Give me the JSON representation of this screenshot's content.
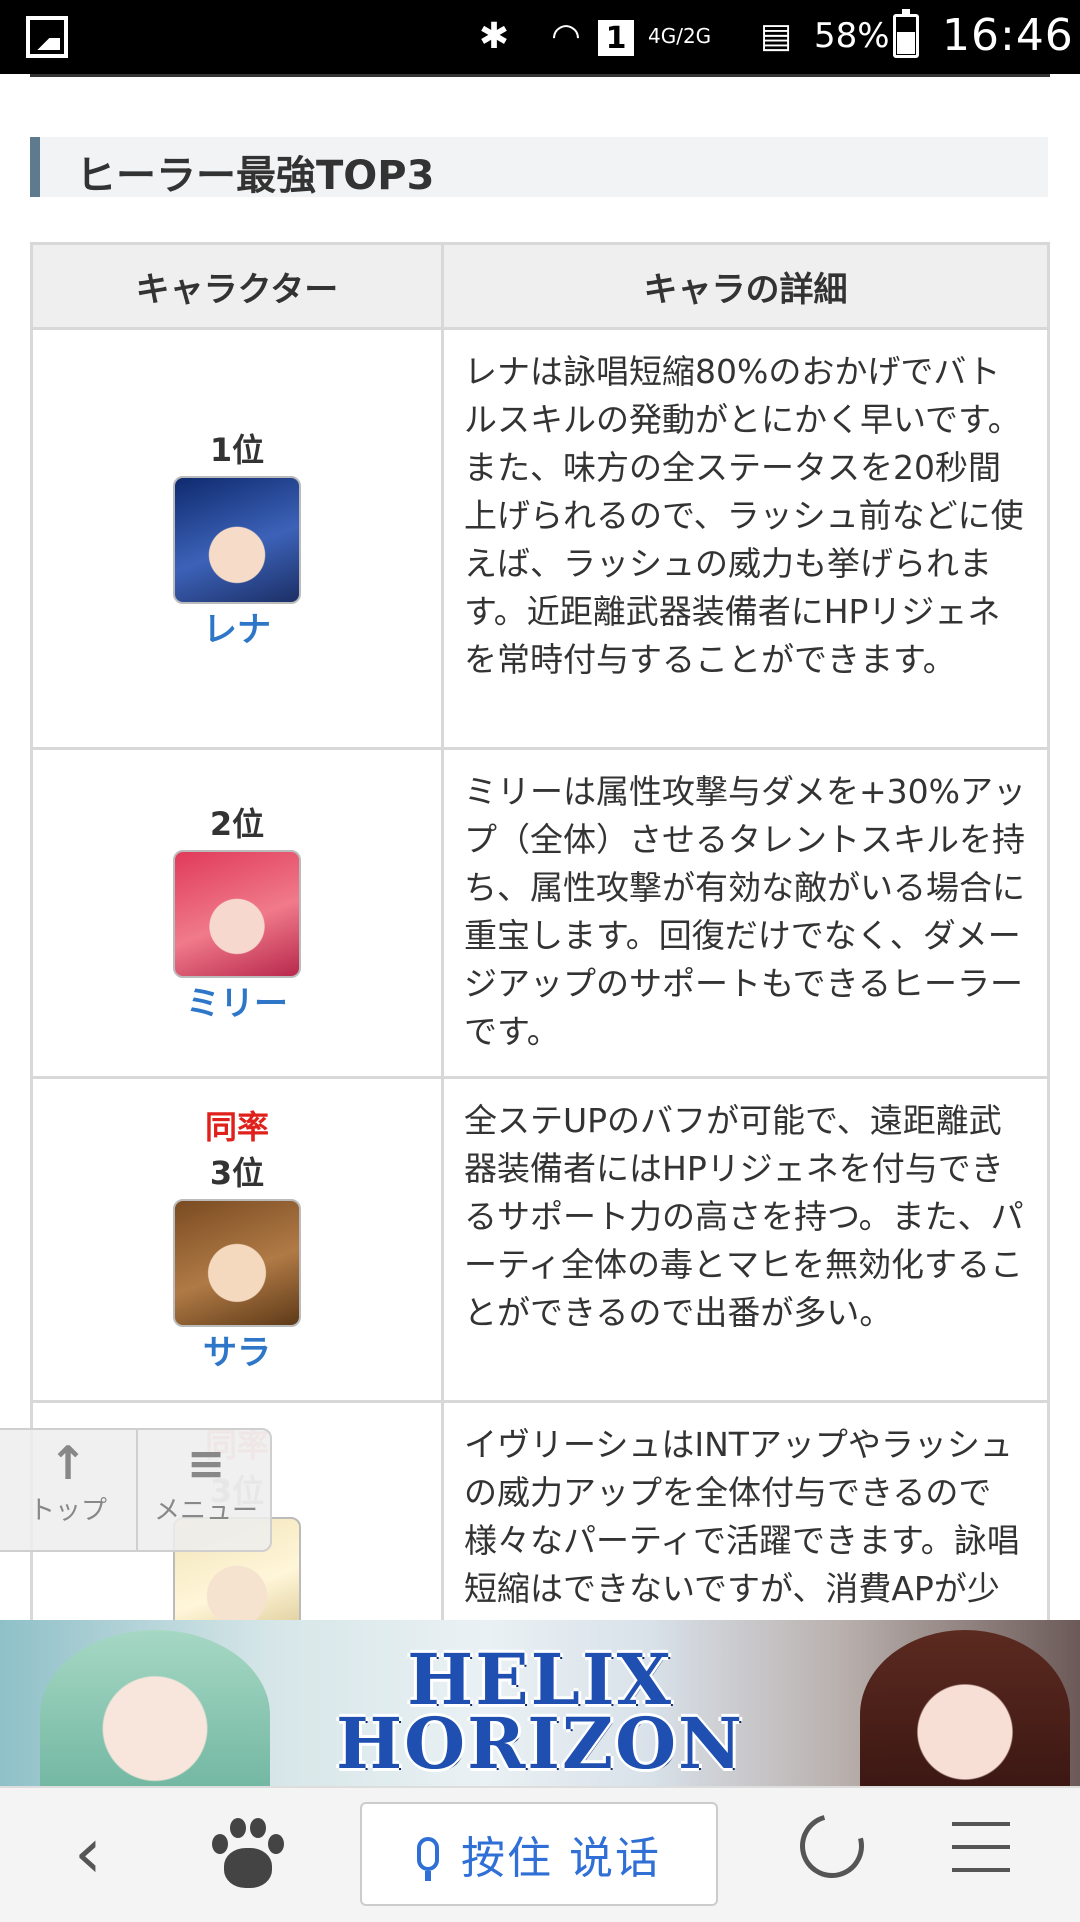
{
  "status_bar": {
    "network_sim": "1",
    "network_type": "4G/2G",
    "battery": "58%",
    "time": "16:46"
  },
  "section": {
    "title": "ヒーラー最強TOP3"
  },
  "table": {
    "headers": [
      "キャラクター",
      "キャラの詳細"
    ],
    "rows": [
      {
        "tie": "",
        "rank": "1位",
        "name": "レナ",
        "avatar_icon": "rena-avatar",
        "description": "レナは詠唱短縮80%のおかげでバトルスキルの発動がとにかく早いです。また、味方の全ステータスを20秒間上げられるので、ラッシュ前などに使えば、ラッシュの威力も挙げられます。近距離武器装備者にHPリジェネを常時付与することができます。"
      },
      {
        "tie": "",
        "rank": "2位",
        "name": "ミリー",
        "avatar_icon": "mily-avatar",
        "description": "ミリーは属性攻撃与ダメを+30%アップ（全体）させるタレントスキルを持ち、属性攻撃が有効な敵がいる場合に重宝します。回復だけでなく、ダメージアップのサポートもできるヒーラーです。"
      },
      {
        "tie": "同率",
        "rank": "3位",
        "name": "サラ",
        "avatar_icon": "sara-avatar",
        "description": "全ステUPのバフが可能で、遠距離武器装備者にはHPリジェネを付与できるサポート力の高さを持つ。また、パーティ全体の毒とマヒを無効化することができるので出番が多い。"
      },
      {
        "tie": "同率",
        "rank": "3位",
        "name": "",
        "avatar_icon": "ivy-avatar",
        "description": "イヴリーシュはINTアップやラッシュの威力アップを全体付与できるので様々なパーティで活躍できます。詠唱短縮はできないですが、消費APが少ないので結束後も連続"
      }
    ]
  },
  "floating_nav": {
    "top_label": "トップ",
    "menu_label": "メニュー"
  },
  "ad": {
    "title_line1": "HELIX",
    "title_line2": "HORIZON"
  },
  "browser_bar": {
    "voice_label": "按住 说话"
  },
  "colors": {
    "accent_link": "#2e76c8",
    "tie_red": "#e0201a",
    "heading_bar": "#5e7a8e"
  }
}
